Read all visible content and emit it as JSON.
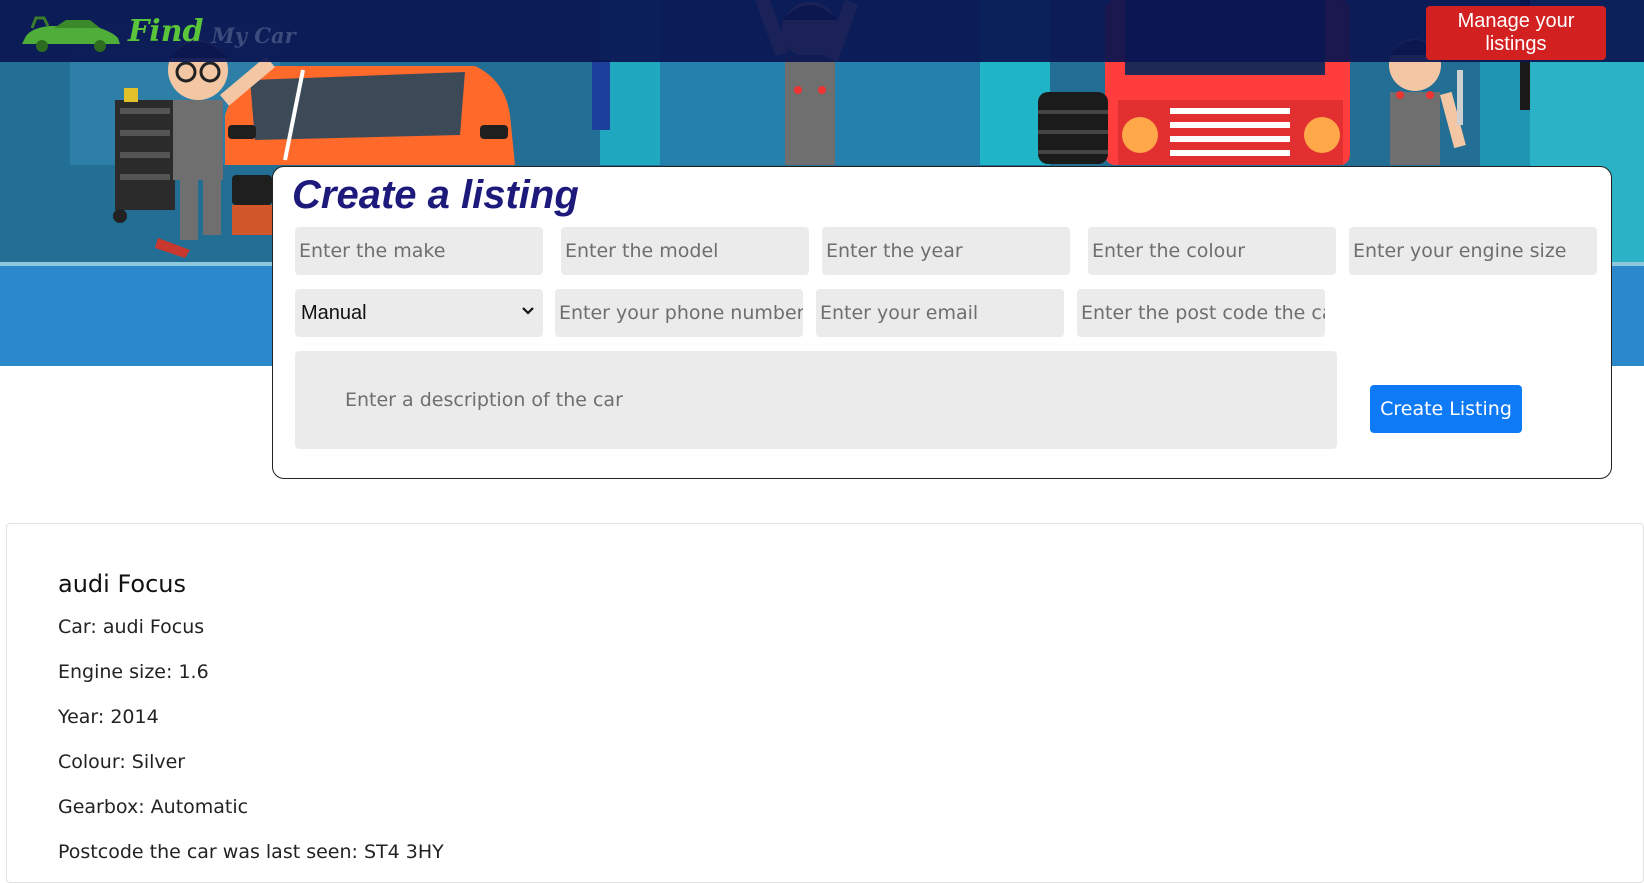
{
  "brand": {
    "name_primary": "Find",
    "name_secondary": "My Car"
  },
  "nav": {
    "manage_label": "Manage your listings"
  },
  "create_form": {
    "title": "Create a listing",
    "make_placeholder": "Enter the make",
    "model_placeholder": "Enter the model",
    "year_placeholder": "Enter the year",
    "colour_placeholder": "Enter the colour",
    "engine_placeholder": "Enter your engine size",
    "gearbox_selected": "Manual",
    "phone_placeholder": "Enter your phone number",
    "email_placeholder": "Enter your email",
    "postcode_placeholder": "Enter the post code the car",
    "description_placeholder": "Enter a description of the car",
    "submit_label": "Create Listing"
  },
  "listing": {
    "title": "audi Focus",
    "lines": [
      "Car: audi Focus",
      "Engine size: 1.6",
      "Year: 2014",
      "Colour: Silver",
      "Gearbox: Automatic",
      "Postcode the car was last seen: ST4 3HY"
    ]
  },
  "colors": {
    "nav_bg": "#0a1652",
    "manage_button": "#d32020",
    "create_button": "#0e7af6",
    "title_color": "#1d1a7c",
    "brand_green": "#5ac53a"
  },
  "icons": {
    "brand_logo": "car-logo-icon",
    "select_arrow": "chevron-down-icon"
  }
}
